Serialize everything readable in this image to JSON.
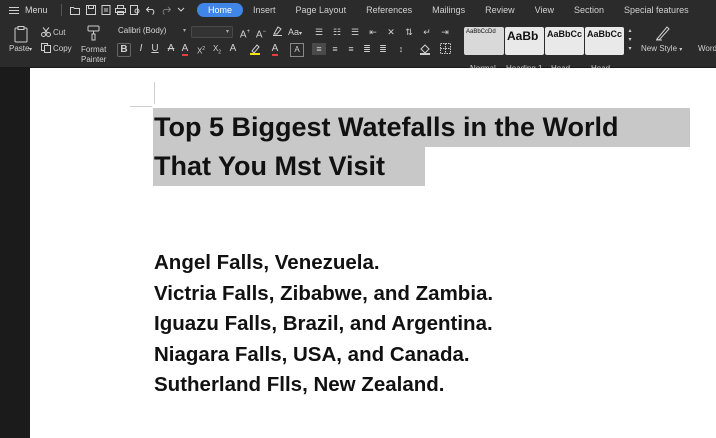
{
  "menubar": {
    "menu_label": "Menu",
    "tabs": [
      "Home",
      "Insert",
      "Page Layout",
      "References",
      "Mailings",
      "Review",
      "View",
      "Section",
      "Special features"
    ]
  },
  "ribbon": {
    "paste": "Paste",
    "cut": "Cut",
    "copy": "Copy",
    "format_painter_1": "Format",
    "format_painter_2": "Painter",
    "font_name": "Calibri (Body)",
    "styles": [
      {
        "preview": "AaBbCcDd",
        "label": "Normal"
      },
      {
        "preview": "AaBb",
        "label": "Heading 1"
      },
      {
        "preview": "AaBbCc",
        "label": "Head..."
      },
      {
        "preview": "AaBbCc",
        "label": "Head..."
      }
    ],
    "new_style": "New Style",
    "word_art": "Word"
  },
  "document": {
    "title_line1": "Top 5 Biggest Watefalls in the World",
    "title_line2": "That You Mst Visit",
    "items": [
      "Angel Falls, Venezuela.",
      "Victria Falls, Zibabwe, and Zambia.",
      "Iguazu Falls, Brazil, and Argentina.",
      "Niagara Falls, USA, and Canada.",
      "Sutherland Flls, New Zealand."
    ]
  },
  "colors": {
    "accent": "#3f86e8",
    "toolbar_bg": "#2b2b2b",
    "selection": "#c8c8c8"
  }
}
